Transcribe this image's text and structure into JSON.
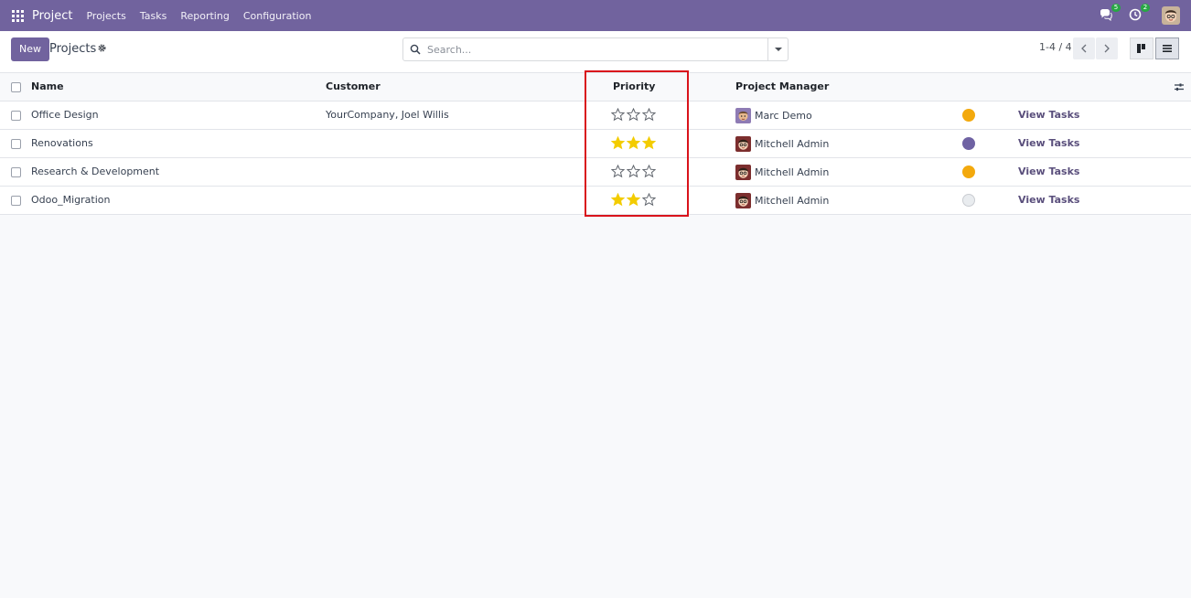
{
  "navbar": {
    "brand": "Project",
    "menu": [
      "Projects",
      "Tasks",
      "Reporting",
      "Configuration"
    ],
    "messages_badge": "5",
    "activity_badge": "2",
    "bg_color": "#71639e"
  },
  "control": {
    "new_label": "New",
    "breadcrumb": "Projects",
    "search_placeholder": "Search...",
    "pager": "1-4 / 4"
  },
  "table": {
    "columns": [
      "Name",
      "Customer",
      "Priority",
      "Project Manager"
    ],
    "rows": [
      {
        "name": "Office Design",
        "customer": "YourCompany, Joel Willis",
        "priority": 0,
        "manager": "Marc Demo",
        "status_color": "#f3a90d",
        "action": "View Tasks"
      },
      {
        "name": "Renovations",
        "customer": "",
        "priority": 3,
        "manager": "Mitchell Admin",
        "status_color": "#6f62a3",
        "action": "View Tasks"
      },
      {
        "name": "Research & Development",
        "customer": "",
        "priority": 0,
        "manager": "Mitchell Admin",
        "status_color": "#f3a90d",
        "action": "View Tasks"
      },
      {
        "name": "Odoo_Migration",
        "customer": "",
        "priority": 2,
        "manager": "Mitchell Admin",
        "status_color": "#e9ecef",
        "action": "View Tasks"
      }
    ],
    "max_priority": 3,
    "star_color": "#f3cc00"
  }
}
